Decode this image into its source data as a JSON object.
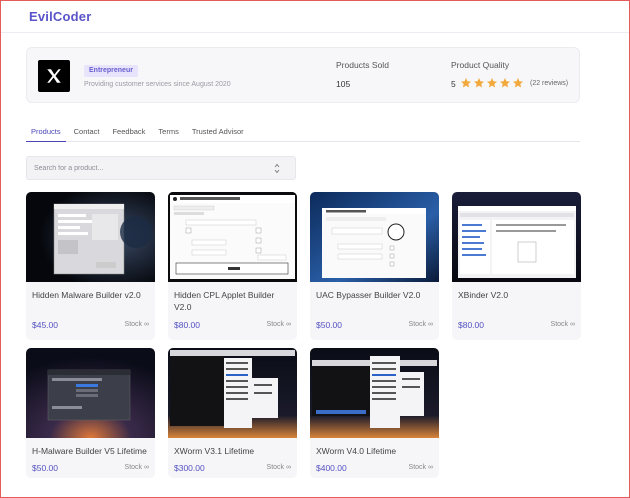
{
  "brand": {
    "name": "EvilCoder"
  },
  "seller": {
    "badge": "Entrepreneur",
    "tagline": "Providing customer services since August 2020",
    "products_sold_label": "Products Sold",
    "products_sold_value": "105",
    "quality_label": "Product Quality",
    "quality_value": "5",
    "rating_stars": 5,
    "reviews": "(22 reviews)"
  },
  "tabs": [
    "Products",
    "Contact",
    "Feedback",
    "Terms",
    "Trusted Advisor"
  ],
  "active_tab": "Products",
  "search": {
    "placeholder": "Search for a product..."
  },
  "products": [
    {
      "title": "Hidden Malware Builder v2.0",
      "price": "$45.00",
      "stock": "Stock ∞"
    },
    {
      "title": "Hidden CPL Applet Builder V2.0",
      "price": "$80.00",
      "stock": "Stock ∞"
    },
    {
      "title": "UAC Bypasser Builder V2.0",
      "price": "$50.00",
      "stock": "Stock ∞"
    },
    {
      "title": "XBinder V2.0",
      "price": "$80.00",
      "stock": "Stock ∞"
    },
    {
      "title": "H-Malware Builder V5 Lifetime",
      "price": "$50.00",
      "stock": "Stock ∞"
    },
    {
      "title": "XWorm V3.1 Lifetime",
      "price": "$300.00",
      "stock": "Stock ∞"
    },
    {
      "title": "XWorm V4.0 Lifetime",
      "price": "$400.00",
      "stock": "Stock ∞"
    }
  ],
  "colors": {
    "accent": "#5a54c8",
    "price": "#5451c2",
    "star": "#f2a93b",
    "frame": "#e65a5a"
  }
}
